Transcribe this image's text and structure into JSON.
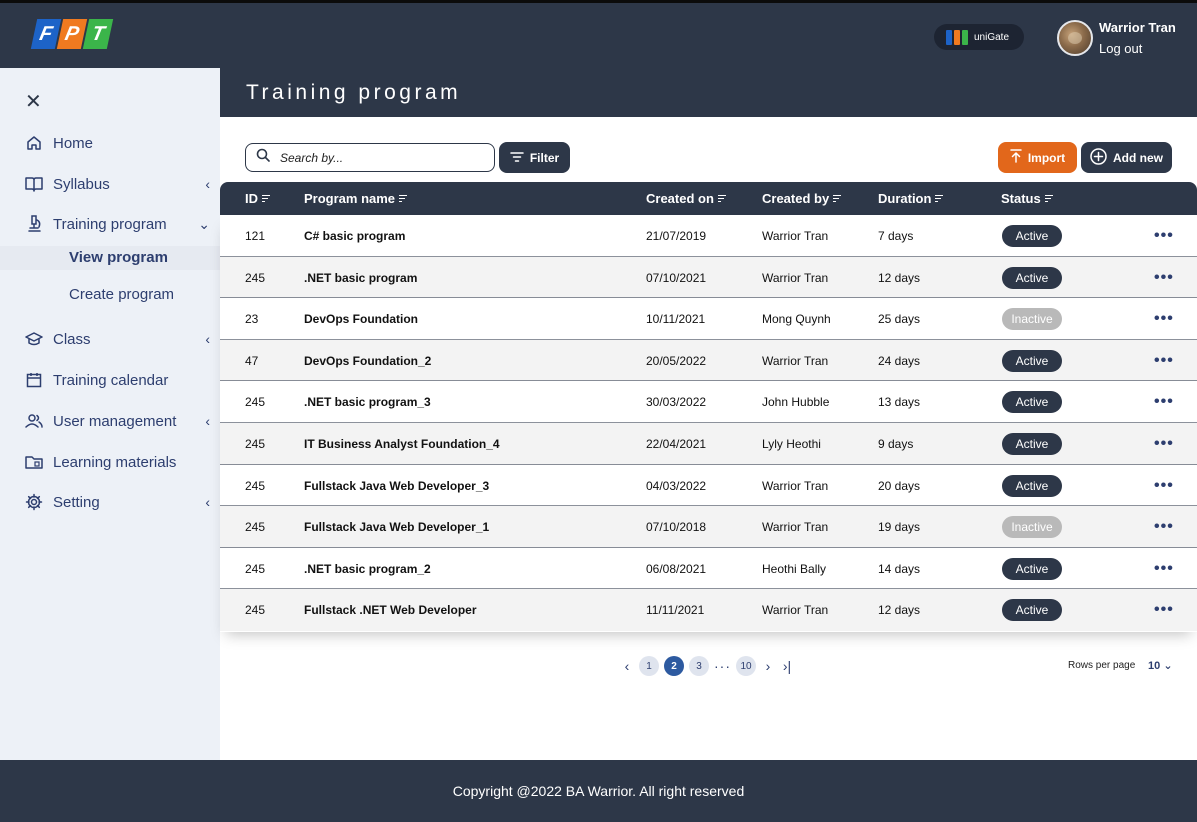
{
  "header": {
    "logo_letters": [
      "F",
      "P",
      "T"
    ],
    "unigate_label": "uniGate",
    "user_name": "Warrior Tran",
    "logout_label": "Log out"
  },
  "sidebar": {
    "items": [
      {
        "label": "Home",
        "icon": "home-icon"
      },
      {
        "label": "Syllabus",
        "icon": "book-icon",
        "has_chevron": true
      },
      {
        "label": "Training program",
        "icon": "microscope-icon",
        "has_chevron": true,
        "expanded": true
      },
      {
        "label": "Class",
        "icon": "graduation-cap-icon",
        "has_chevron": true
      },
      {
        "label": "Training calendar",
        "icon": "calendar-icon"
      },
      {
        "label": "User management",
        "icon": "users-icon",
        "has_chevron": true
      },
      {
        "label": "Learning materials",
        "icon": "folder-icon"
      },
      {
        "label": "Setting",
        "icon": "gear-icon",
        "has_chevron": true
      }
    ],
    "sub_items": [
      {
        "label": "View program",
        "active": true
      },
      {
        "label": "Create program",
        "active": false
      }
    ]
  },
  "page": {
    "title": "Training program"
  },
  "toolbar": {
    "search_placeholder": "Search by...",
    "filter_label": "Filter",
    "import_label": "Import",
    "add_label": "Add new"
  },
  "table": {
    "columns": [
      "ID",
      "Program name",
      "Created on",
      "Created by",
      "Duration",
      "Status"
    ],
    "rows": [
      {
        "id": "121",
        "name": "C# basic program",
        "created_on": "21/07/2019",
        "created_by": "Warrior Tran",
        "duration": "7 days",
        "status": "Active"
      },
      {
        "id": "245",
        "name": ".NET basic program",
        "created_on": "07/10/2021",
        "created_by": "Warrior Tran",
        "duration": "12 days",
        "status": "Active"
      },
      {
        "id": "23",
        "name": "DevOps Foundation",
        "created_on": "10/11/2021",
        "created_by": "Mong Quynh",
        "duration": "25 days",
        "status": "Inactive"
      },
      {
        "id": "47",
        "name": "DevOps Foundation_2",
        "created_on": "20/05/2022",
        "created_by": "Warrior Tran",
        "duration": "24 days",
        "status": "Active"
      },
      {
        "id": "245",
        "name": ".NET basic program_3",
        "created_on": "30/03/2022",
        "created_by": "John Hubble",
        "duration": "13 days",
        "status": "Active"
      },
      {
        "id": "245",
        "name": "IT Business Analyst Foundation_4",
        "created_on": "22/04/2021",
        "created_by": "Lyly Heothi",
        "duration": "9 days",
        "status": "Active"
      },
      {
        "id": "245",
        "name": "Fullstack Java Web Developer_3",
        "created_on": "04/03/2022",
        "created_by": "Warrior Tran",
        "duration": "20 days",
        "status": "Active"
      },
      {
        "id": "245",
        "name": "Fullstack Java Web Developer_1",
        "created_on": "07/10/2018",
        "created_by": "Warrior Tran",
        "duration": "19 days",
        "status": "Inactive"
      },
      {
        "id": "245",
        "name": ".NET basic program_2",
        "created_on": "06/08/2021",
        "created_by": "Heothi Bally",
        "duration": "14 days",
        "status": "Active"
      },
      {
        "id": "245",
        "name": "Fullstack .NET Web Developer",
        "created_on": "11/11/2021",
        "created_by": "Warrior Tran",
        "duration": "12 days",
        "status": "Active"
      }
    ]
  },
  "pagination": {
    "pages": [
      "1",
      "2",
      "3",
      "10"
    ],
    "current": "2",
    "ellipsis": "···",
    "rows_per_page_label": "Rows per page",
    "rows_per_page_value": "10"
  },
  "footer": {
    "copyright": "Copyright @2022 BA Warrior. All right reserved"
  },
  "colors": {
    "primary": "#2d3748",
    "accent": "#e2671b",
    "sidebar_bg": "#edf1f7",
    "inactive": "#b9b9b9"
  }
}
